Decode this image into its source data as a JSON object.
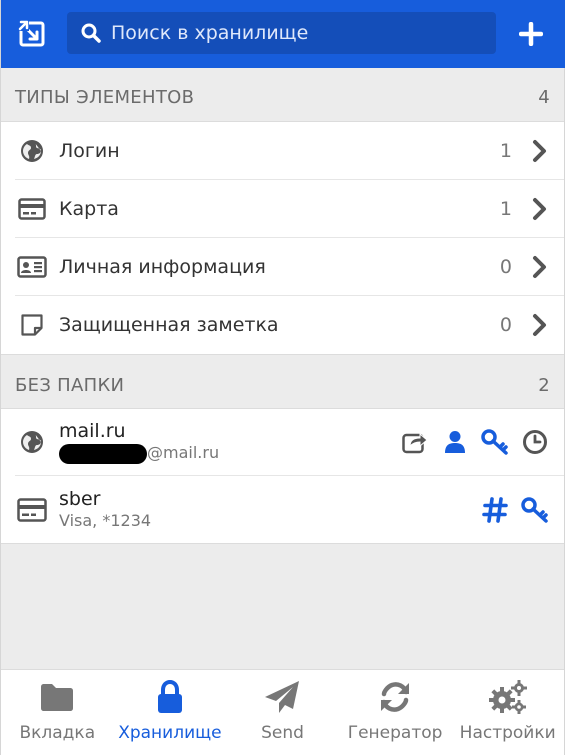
{
  "header": {
    "search_placeholder": "Поиск в хранилище",
    "colors": {
      "brand": "#175ddc",
      "search_bg": "#144eb9"
    }
  },
  "types": {
    "heading": "ТИПЫ ЭЛЕМЕНТОВ",
    "count": "4",
    "rows": [
      {
        "label": "Логин",
        "count": "1",
        "icon": "globe-icon"
      },
      {
        "label": "Карта",
        "count": "1",
        "icon": "credit-card-icon"
      },
      {
        "label": "Личная информация",
        "count": "0",
        "icon": "id-card-icon"
      },
      {
        "label": "Защищенная заметка",
        "count": "0",
        "icon": "sticky-note-icon"
      }
    ]
  },
  "no_folder": {
    "heading": "БЕЗ ПАПКИ",
    "count": "2",
    "items": [
      {
        "title": "mail.ru",
        "subtitle": "@mail.ru",
        "icon": "globe-icon",
        "actions": [
          "launch-icon",
          "copy-username-icon",
          "copy-password-icon",
          "copy-totp-icon"
        ]
      },
      {
        "title": "sber",
        "subtitle": "Visa, *1234",
        "icon": "credit-card-icon",
        "actions": [
          "copy-number-icon",
          "copy-security-code-icon"
        ]
      }
    ]
  },
  "tabs": [
    {
      "label": "Вкладка",
      "icon": "folder-icon",
      "active": false
    },
    {
      "label": "Хранилище",
      "icon": "lock-icon",
      "active": true
    },
    {
      "label": "Send",
      "icon": "paper-plane-icon",
      "active": false
    },
    {
      "label": "Генератор",
      "icon": "refresh-icon",
      "active": false
    },
    {
      "label": "Настройки",
      "icon": "cogs-icon",
      "active": false
    }
  ]
}
